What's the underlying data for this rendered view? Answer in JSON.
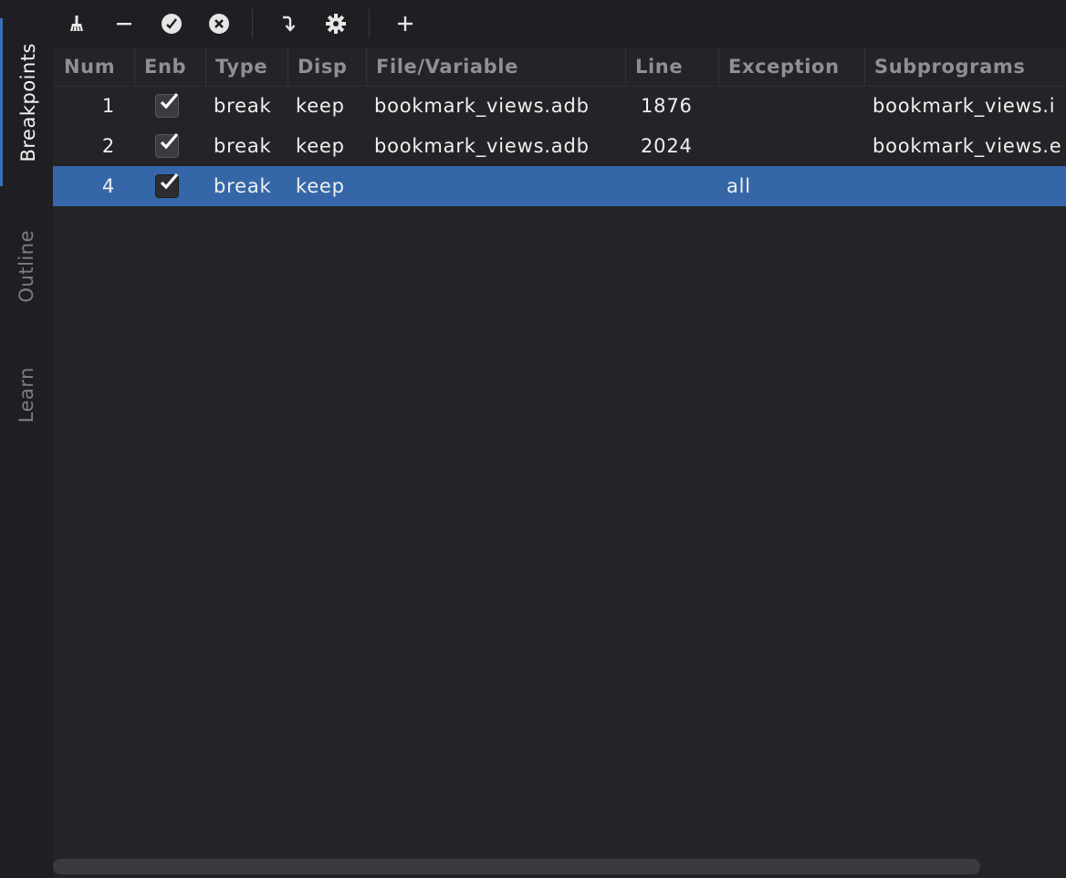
{
  "sidebar": {
    "tabs": [
      {
        "label": "Breakpoints",
        "active": true
      },
      {
        "label": "Outline",
        "active": false
      },
      {
        "label": "Learn",
        "active": false
      }
    ]
  },
  "toolbar": {
    "buttons": [
      {
        "name": "clear-icon",
        "glyph": "⚗"
      },
      {
        "name": "remove-icon",
        "glyph": "−"
      },
      {
        "name": "enable-all-icon",
        "glyph": "✓"
      },
      {
        "name": "disable-all-icon",
        "glyph": "✕"
      },
      {
        "name": "goto-location-icon",
        "glyph": "⤵"
      },
      {
        "name": "settings-icon",
        "glyph": "⚙"
      },
      {
        "name": "add-icon",
        "glyph": "+"
      }
    ]
  },
  "table": {
    "columns": [
      "Num",
      "Enb",
      "Type",
      "Disp",
      "File/Variable",
      "Line",
      "Exception",
      "Subprograms"
    ],
    "rows": [
      {
        "num": "1",
        "enabled": true,
        "type": "break",
        "disp": "keep",
        "file": "bookmark_views.adb",
        "line": "1876",
        "exception": "",
        "subprogram": "bookmark_views.i",
        "selected": false
      },
      {
        "num": "2",
        "enabled": true,
        "type": "break",
        "disp": "keep",
        "file": "bookmark_views.adb",
        "line": "2024",
        "exception": "",
        "subprogram": "bookmark_views.e",
        "selected": false
      },
      {
        "num": "4",
        "enabled": true,
        "type": "break",
        "disp": "keep",
        "file": "",
        "line": "",
        "exception": "all",
        "subprogram": "",
        "selected": true
      }
    ]
  },
  "colors": {
    "background": "#1e1f22",
    "panel": "#232427",
    "selection": "#3567a8",
    "header_text": "#8e9094",
    "active_tab_accent": "#3b6fb5"
  }
}
